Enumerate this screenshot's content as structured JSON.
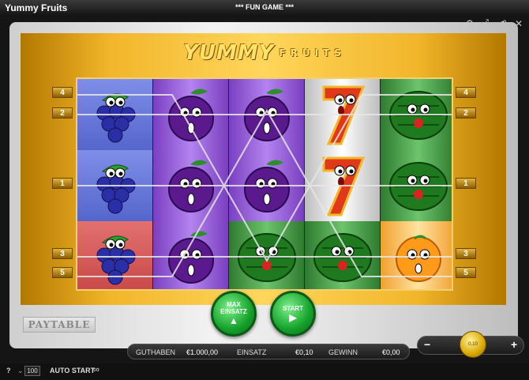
{
  "window": {
    "title": "Yummy Fruits",
    "mode": "*** FUN GAME ***"
  },
  "controls": {
    "settings_icon": "gear-icon",
    "fullscreen_icon": "fullscreen-icon",
    "sound_icon": "sound-icon",
    "close_icon": "close-icon"
  },
  "logo": {
    "word1": "YUMMY",
    "word2": "FRUITS"
  },
  "paylines": {
    "left": [
      "4",
      "2",
      "1",
      "3",
      "5"
    ],
    "right": [
      "4",
      "2",
      "1",
      "3",
      "5"
    ]
  },
  "reels": [
    [
      "grapes",
      "grapes",
      "grapes"
    ],
    [
      "plum",
      "plum",
      "plum"
    ],
    [
      "plum",
      "plum",
      "melon"
    ],
    [
      "seven",
      "seven",
      "melon"
    ],
    [
      "melon",
      "melon",
      "orange"
    ]
  ],
  "buttons": {
    "max_line1": "MAX",
    "max_line2": "EINSATZ",
    "start": "START",
    "paytable": "PAYTABLE"
  },
  "info": {
    "guthaben_label": "GUTHABEN",
    "guthaben_value": "€1.000,00",
    "einsatz_label": "EINSATZ",
    "einsatz_value": "€0,10",
    "gewinn_label": "GEWINN",
    "gewinn_value": "€0,00"
  },
  "bet": {
    "minus": "−",
    "plus": "+",
    "coin_value": "0,10"
  },
  "footer": {
    "help": "?",
    "autostart_count": "100",
    "autostart_label": "AUTO START"
  }
}
